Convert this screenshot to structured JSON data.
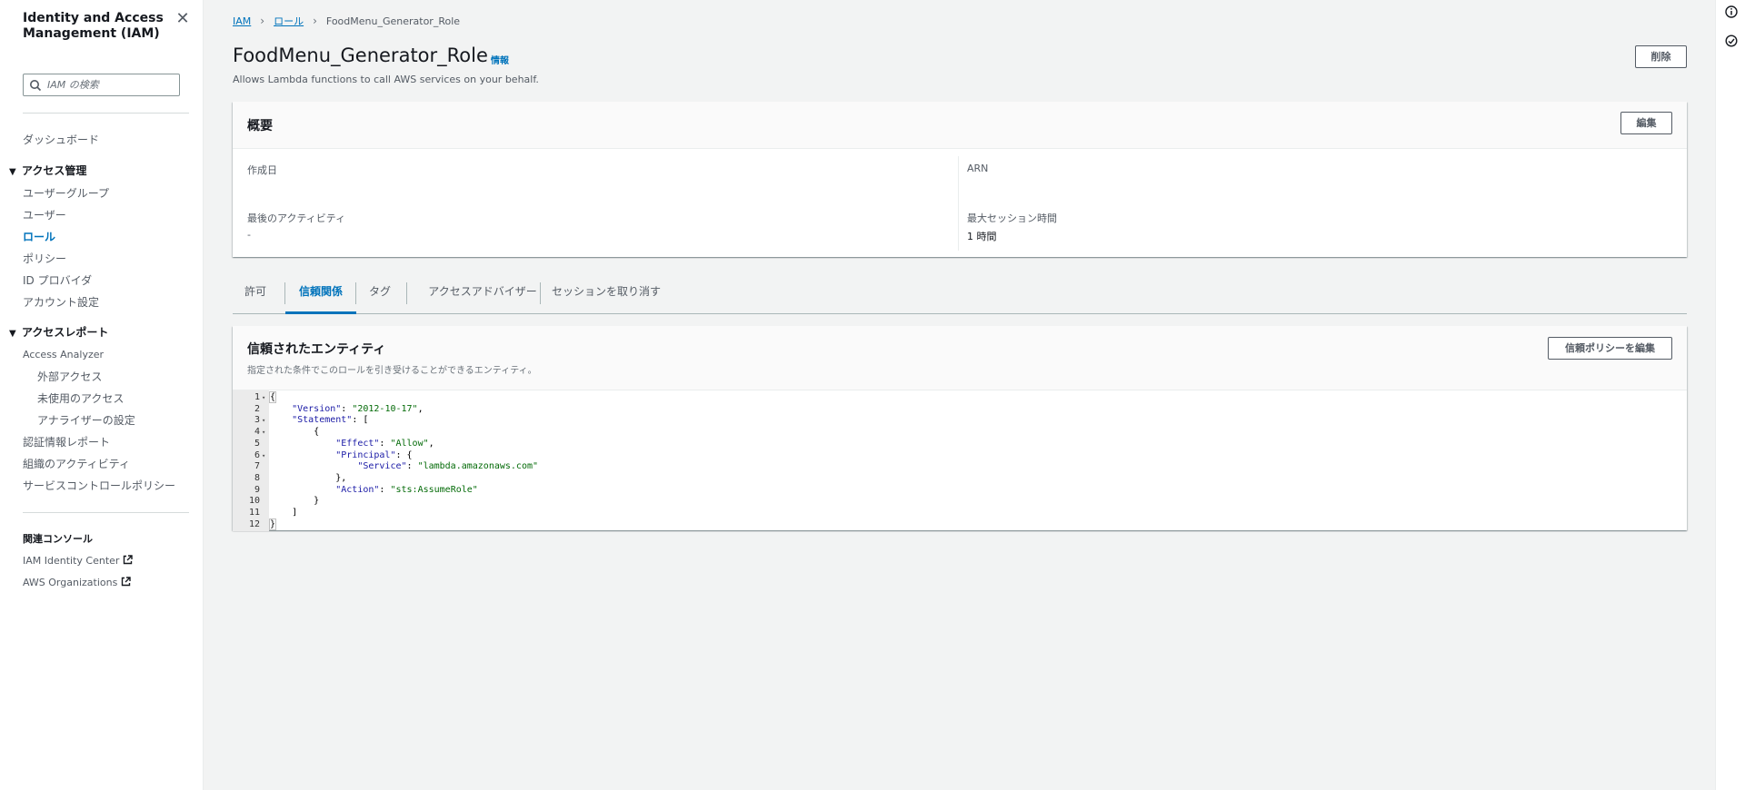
{
  "sidebar": {
    "title": "Identity and Access Management (IAM)",
    "close_label": "✕",
    "search_placeholder": "IAM の検索",
    "dashboard": "ダッシュボード",
    "access_management": {
      "label": "アクセス管理",
      "items": [
        "ユーザーグループ",
        "ユーザー",
        "ロール",
        "ポリシー",
        "ID プロバイダ",
        "アカウント設定"
      ],
      "active": "ロール"
    },
    "access_reports": {
      "label": "アクセスレポート",
      "analyzer": "Access Analyzer",
      "analyzer_items": [
        "外部アクセス",
        "未使用のアクセス",
        "アナライザーの設定"
      ],
      "items": [
        "認証情報レポート",
        "組織のアクティビティ",
        "サービスコントロールポリシー"
      ]
    },
    "related_consoles": {
      "label": "関連コンソール",
      "items": [
        "IAM Identity Center",
        "AWS Organizations"
      ]
    }
  },
  "breadcrumb": {
    "items": [
      "IAM",
      "ロール",
      "FoodMenu_Generator_Role"
    ]
  },
  "header": {
    "title": "FoodMenu_Generator_Role",
    "info_label": "情報",
    "description": "Allows Lambda functions to call AWS services on your behalf.",
    "delete_label": "削除"
  },
  "summary": {
    "title": "概要",
    "edit_label": "編集",
    "created_label": "作成日",
    "created_value": "",
    "arn_label": "ARN",
    "arn_value": "",
    "last_activity_label": "最後のアクティビティ",
    "last_activity_value": "-",
    "max_session_label": "最大セッション時間",
    "max_session_value": "1 時間"
  },
  "tabs": {
    "items": [
      "許可",
      "信頼関係",
      "タグ",
      "アクセスアドバイザー",
      "セッションを取り消す"
    ],
    "active": "信頼関係"
  },
  "trusted": {
    "title": "信頼されたエンティティ",
    "description": "指定された条件でこのロールを引き受けることができるエンティティ。",
    "edit_label": "信頼ポリシーを編集",
    "line_numbers": [
      "1",
      "2",
      "3",
      "4",
      "5",
      "6",
      "7",
      "8",
      "9",
      "10",
      "11",
      "12"
    ],
    "code": {
      "l1": "{",
      "l2_key": "\"Version\"",
      "l2_val": "\"2012-10-17\"",
      "l3_key": "\"Statement\"",
      "l3_rest": ": [",
      "l4": "{",
      "l5_key": "\"Effect\"",
      "l5_val": "\"Allow\"",
      "l6_key": "\"Principal\"",
      "l6_rest": ": {",
      "l7_key": "\"Service\"",
      "l7_val": "\"lambda.amazonaws.com\"",
      "l8": "},",
      "l9_key": "\"Action\"",
      "l9_val": "\"sts:AssumeRole\"",
      "l10": "}",
      "l11": "]",
      "l12": "}"
    }
  },
  "colors": {
    "link": "#0073bb",
    "text": "#16191f",
    "muted": "#545b64",
    "background": "#f2f3f3"
  }
}
